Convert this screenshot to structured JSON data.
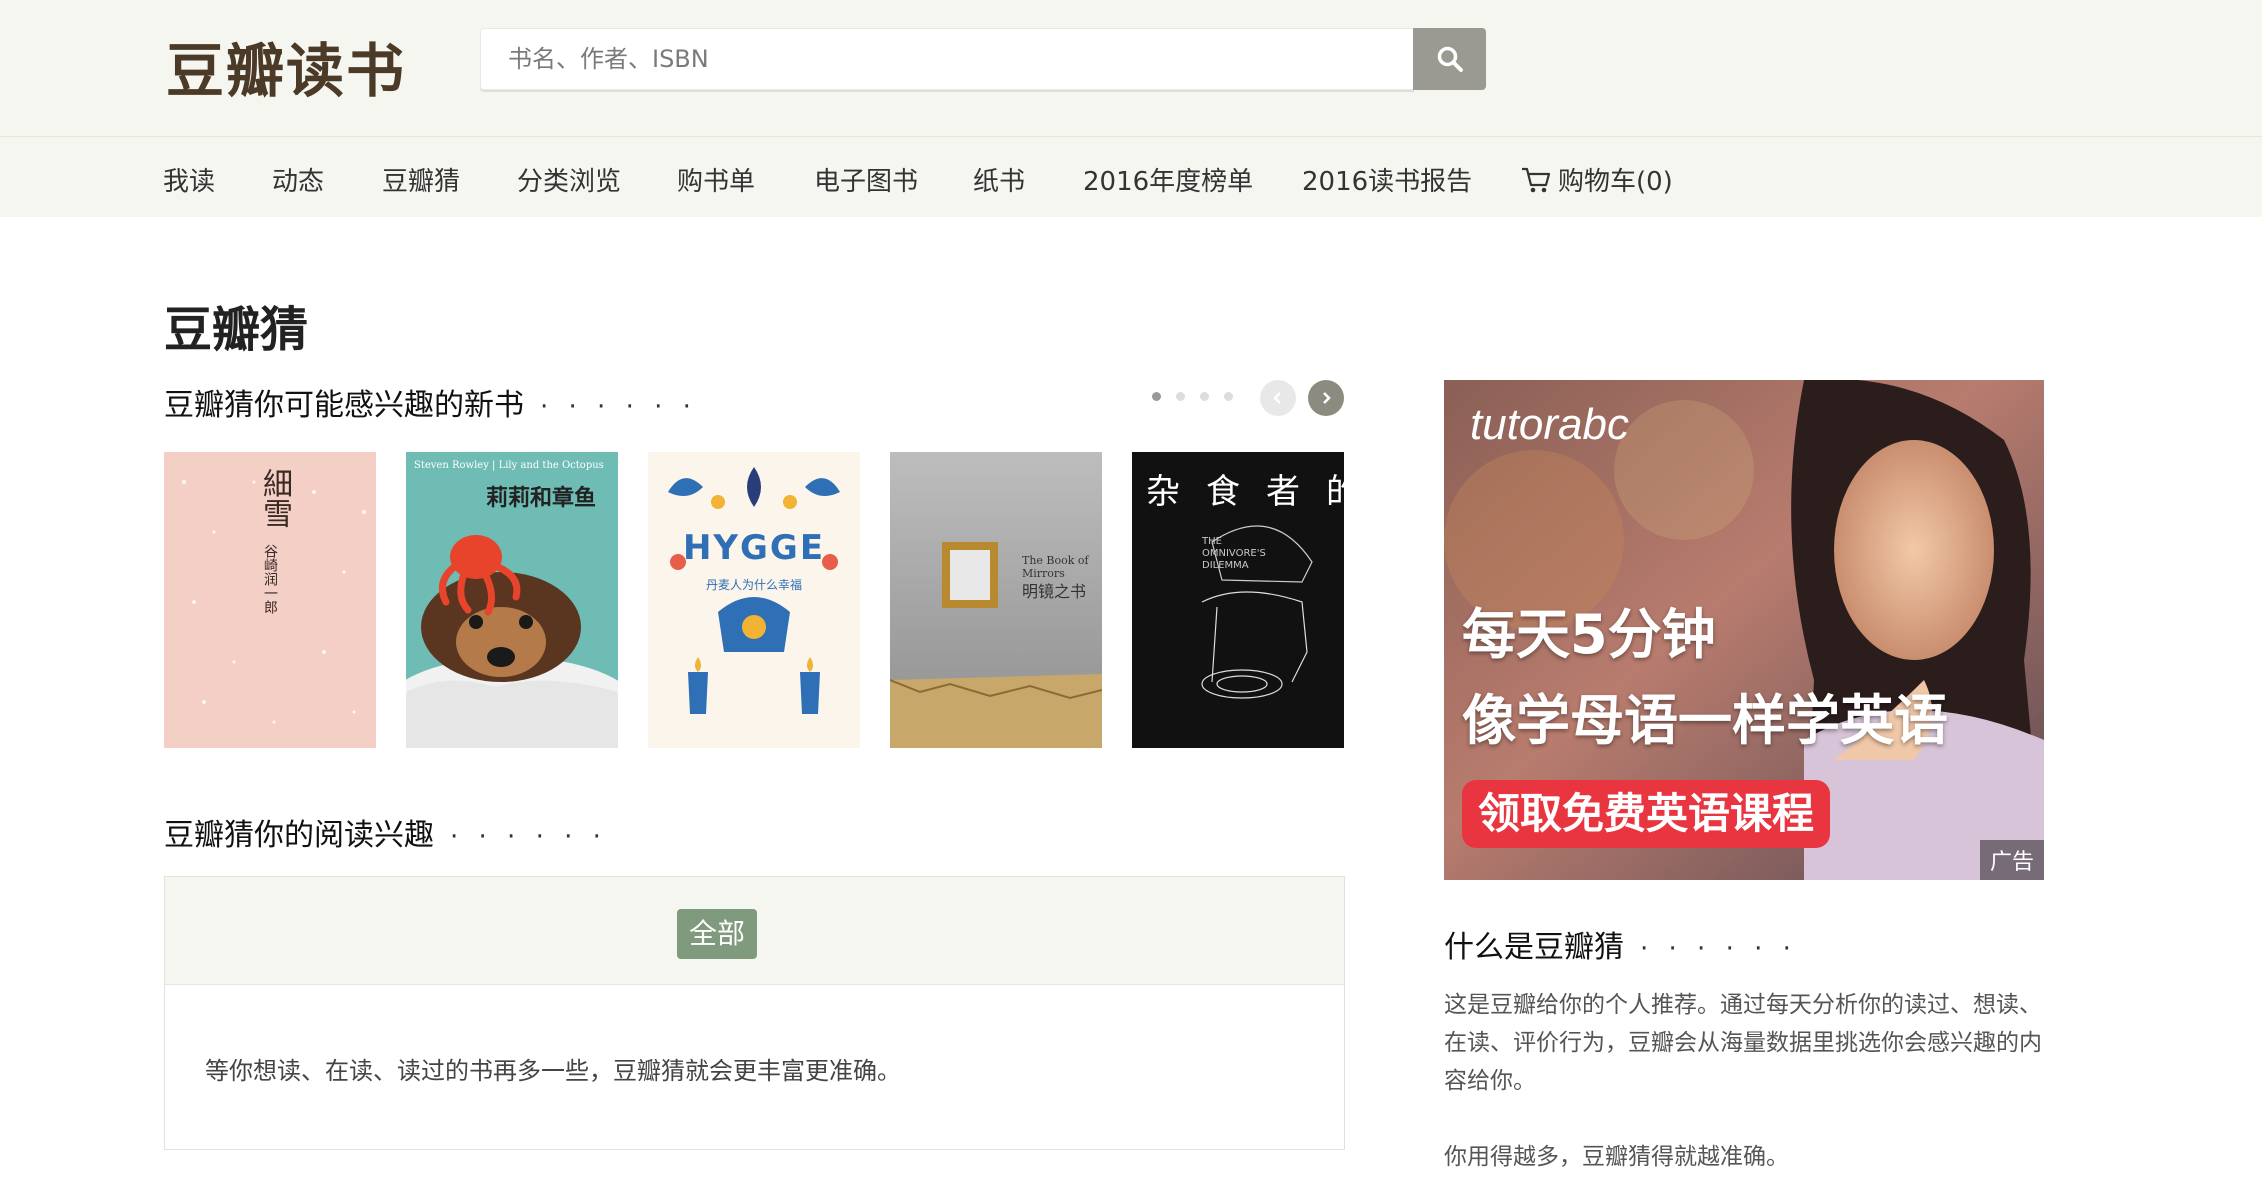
{
  "header": {
    "logo": "豆瓣读书",
    "search_placeholder": "书名、作者、ISBN"
  },
  "nav": {
    "items": [
      {
        "label": "我读"
      },
      {
        "label": "动态"
      },
      {
        "label": "豆瓣猜"
      },
      {
        "label": "分类浏览"
      },
      {
        "label": "购书单"
      },
      {
        "label": "电子图书"
      },
      {
        "label": "纸书"
      },
      {
        "label": "2016年度榜单"
      },
      {
        "label": "2016读书报告"
      },
      {
        "label": "购物车(0)",
        "icon": "cart-icon"
      }
    ]
  },
  "main": {
    "page_title": "豆瓣猜",
    "new_books": {
      "title": "豆瓣猜你可能感兴趣的新书",
      "more": "· · · · · ·",
      "carousel_pages": 4,
      "carousel_active": 1,
      "books": [
        {
          "cover_title": "細雪",
          "cover_author": "谷崎润一郎",
          "color": "#f3cfc6"
        },
        {
          "cover_title": "莉莉和章鱼",
          "cover_subtitle": "Steven Rowley | Lily and the Octopus",
          "color": "#6fbcb5"
        },
        {
          "cover_title": "HYGGE",
          "cover_subtitle": "丹麦人为什么幸福",
          "color": "#fbf5ec"
        },
        {
          "cover_title": "明镜之书",
          "cover_subtitle": "The Book of Mirrors",
          "color": "#a9a9a9"
        },
        {
          "cover_title": "杂食者的两难",
          "cover_subtitle": "THE OMNIVORE'S DILEMMA",
          "color": "#111111"
        }
      ]
    },
    "interests": {
      "title": "豆瓣猜你的阅读兴趣",
      "more": "· · · · · ·",
      "tag_all": "全部",
      "message": "等你想读、在读、读过的书再多一些，豆瓣猜就会更丰富更准确。"
    }
  },
  "sidebar": {
    "ad": {
      "brand": "tutorabc",
      "line1": "每天5分钟",
      "line2": "像学母语一样学英语",
      "cta": "领取免费英语课程",
      "tag": "广告"
    },
    "about": {
      "title": "什么是豆瓣猜",
      "more": "· · · · · ·",
      "para1": "这是豆瓣给你的个人推荐。通过每天分析你的读过、想读、在读、评价行为，豆瓣会从海量数据里挑选你会感兴趣的内容给你。",
      "para2": "你用得越多，豆瓣猜得就越准确。"
    }
  },
  "colors": {
    "header_bg": "#f6f6f1",
    "logo": "#4b3a27",
    "tag_green": "#7f9a7c",
    "ad_red": "#e8353f"
  }
}
